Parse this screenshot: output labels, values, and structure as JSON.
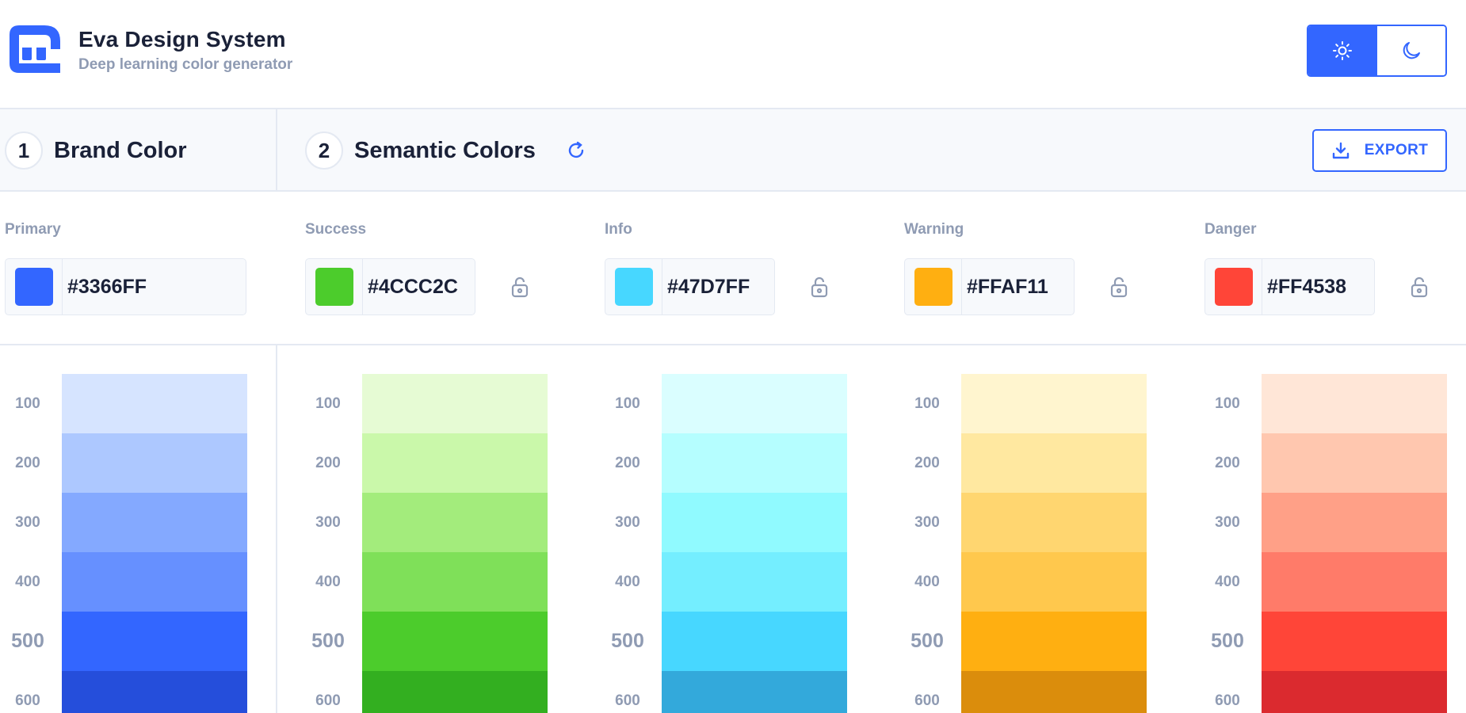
{
  "app": {
    "title": "Eva Design System",
    "subtitle": "Deep learning color generator"
  },
  "theme_toggle": {
    "active": "light",
    "light_icon": "sun-icon",
    "dark_icon": "moon-icon"
  },
  "steps": [
    {
      "number": "1",
      "title": "Brand Color"
    },
    {
      "number": "2",
      "title": "Semantic Colors"
    }
  ],
  "export": {
    "label": "EXPORT",
    "icon": "download-icon"
  },
  "accent_color": "#3366FF",
  "groups": [
    {
      "name": "Primary",
      "hex": "#3366FF",
      "lockable": false,
      "shades": [
        {
          "label": "100",
          "color": "#D6E4FF"
        },
        {
          "label": "200",
          "color": "#ADC8FF"
        },
        {
          "label": "300",
          "color": "#84A9FF"
        },
        {
          "label": "400",
          "color": "#6690FF"
        },
        {
          "label": "500",
          "color": "#3366FF"
        },
        {
          "label": "600",
          "color": "#254EDB"
        }
      ]
    },
    {
      "name": "Success",
      "hex": "#4CCC2C",
      "lockable": true,
      "shades": [
        {
          "label": "100",
          "color": "#E6FBD4"
        },
        {
          "label": "200",
          "color": "#CAF8AA"
        },
        {
          "label": "300",
          "color": "#A3EC7C"
        },
        {
          "label": "400",
          "color": "#7FE059"
        },
        {
          "label": "500",
          "color": "#4CCC2C"
        },
        {
          "label": "600",
          "color": "#33AF20"
        }
      ]
    },
    {
      "name": "Info",
      "hex": "#47D7FF",
      "lockable": true,
      "shades": [
        {
          "label": "100",
          "color": "#DAFEFF"
        },
        {
          "label": "200",
          "color": "#B5FEFF"
        },
        {
          "label": "300",
          "color": "#90FAFF"
        },
        {
          "label": "400",
          "color": "#74EEFF"
        },
        {
          "label": "500",
          "color": "#47D7FF"
        },
        {
          "label": "600",
          "color": "#33A9DB"
        }
      ]
    },
    {
      "name": "Warning",
      "hex": "#FFAF11",
      "lockable": true,
      "shades": [
        {
          "label": "100",
          "color": "#FFF5CF"
        },
        {
          "label": "200",
          "color": "#FFE8A0"
        },
        {
          "label": "300",
          "color": "#FFD670"
        },
        {
          "label": "400",
          "color": "#FFC84D"
        },
        {
          "label": "500",
          "color": "#FFAF11"
        },
        {
          "label": "600",
          "color": "#DB8D0C"
        }
      ]
    },
    {
      "name": "Danger",
      "hex": "#FF4538",
      "lockable": true,
      "shades": [
        {
          "label": "100",
          "color": "#FFE6D7"
        },
        {
          "label": "200",
          "color": "#FFC7AF"
        },
        {
          "label": "300",
          "color": "#FFA087"
        },
        {
          "label": "400",
          "color": "#FF7B69"
        },
        {
          "label": "500",
          "color": "#FF4538"
        },
        {
          "label": "600",
          "color": "#DB2A2F"
        }
      ]
    }
  ]
}
